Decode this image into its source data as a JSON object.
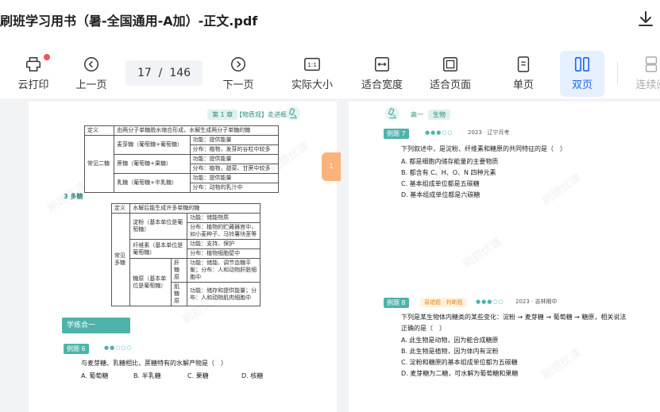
{
  "title": "刷班学习用书（暑-全国通用-A加）-正文.pdf",
  "toolbar": {
    "print": "云打印",
    "prev": "上一页",
    "page_current": "17",
    "page_total": "146",
    "next": "下一页",
    "actual": "实际大小",
    "fit_width": "适合宽度",
    "fit_page": "适合页面",
    "single": "单页",
    "double": "双页",
    "continuous": "连续阅",
    "actual_icon_text": "1:1"
  },
  "colors": {
    "accent": "#1e6bf0",
    "tab": "#fbb27b",
    "teal": "#4fb3a9"
  },
  "side_tabs": {
    "left": "1",
    "right": "1"
  },
  "left_page": {
    "header_tag": "第 1 章",
    "header_title": "【物质观】走进细胞",
    "table1": {
      "caption": "由两分子单糖脱水缩合形成，水解生成两分子单糖的糖",
      "col0": "定义",
      "group": "常见二糖",
      "rows": [
        [
          "麦芽糖（葡萄糖+葡萄糖）",
          "功能：提供能量",
          "分布：植物，发芽的谷粒中较多"
        ],
        [
          "蔗糖（葡萄糖+果糖）",
          "功能：提供能量",
          "分布：植物，甜菜、甘蔗中较多"
        ],
        [
          "乳糖（葡萄糖+半乳糖）",
          "功能：提供能量",
          "分布：动物的乳汁中"
        ]
      ]
    },
    "section3": "3 多糖",
    "table2": {
      "caption": "水解后能生成许多单糖的糖",
      "col0": "定义",
      "group": "常见多糖",
      "rows": [
        [
          "淀粉（基本单位是葡萄糖）",
          "功能：储能物质",
          "分布：植物的贮藏器官中，如小麦种子、马铃薯块茎等"
        ],
        [
          "纤维素（基本单位是葡萄糖）",
          "功能：支持、保护",
          "分布：植物细胞壁中"
        ],
        [
          "糖原（基本单位是葡萄糖）",
          "肝糖原",
          "功能：储能、调节血糖平衡；分布：人和动物肝脏细胞中"
        ],
        [
          "",
          "肌糖原",
          "功能：储存和提供能量；分布：人和动物肌肉细胞中"
        ]
      ]
    },
    "practice_label": "学练合一",
    "q6_no": "例题 6",
    "q6_text": "与麦芽糖、乳糖相比，蔗糖特有的水解产物是（　）",
    "q6_options": [
      "A. 葡萄糖",
      "B. 半乳糖",
      "C. 果糖",
      "D. 核糖"
    ]
  },
  "right_page": {
    "header_tag": "高一",
    "header_title": "生物",
    "q7_no": "例题 7",
    "q7_meta": "2023 · 辽宁月考",
    "q7_text": "下列叙述中，是淀粉、纤维素和糖原的共同特征的是（　）",
    "q7_options": [
      "A. 都是细胞内储存能量的主要物质",
      "B. 都含有 C、H、O、N 四种元素",
      "C. 基本组成单位都是五碳糖",
      "D. 基本组成单位都是六碳糖"
    ],
    "q8_no": "例题 8",
    "q8_tag": "易错题 · 判断题",
    "q8_meta": "2023 · 吉林期中",
    "q8_text1": "下列是某生物体内糖类的某些变化：淀粉 → 麦芽糖 → 葡萄糖 → 糖原，相关说法",
    "q8_text2": "正确的是（　）",
    "q8_options": [
      "A. 此生物是动物，因为能合成糖原",
      "B. 此生物是植物，因为体内有淀粉",
      "C. 淀粉和糖原的基本组成单位都为五碳糖",
      "D. 麦芽糖为二糖，可水解为葡萄糖和果糖"
    ]
  },
  "watermark": "刷题优课"
}
